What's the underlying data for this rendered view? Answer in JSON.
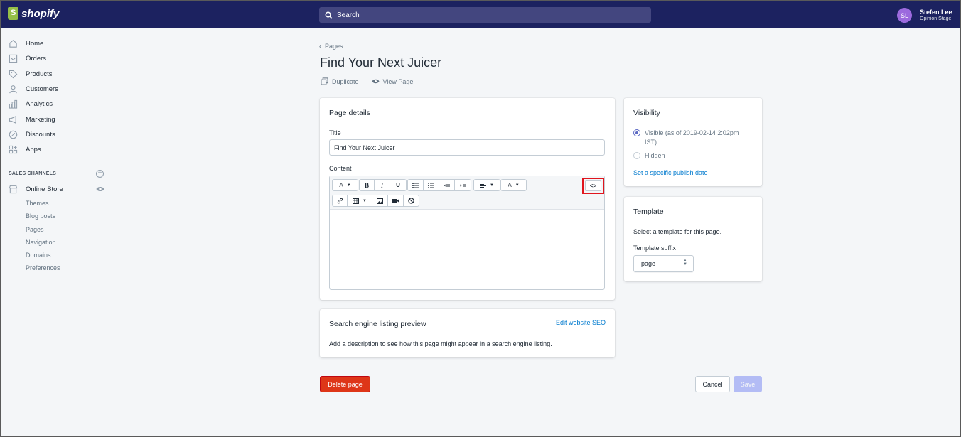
{
  "topbar": {
    "brand": "shopify",
    "search_placeholder": "Search",
    "user": {
      "initials": "SL",
      "name": "Stefen Lee",
      "store": "Opinion Stage"
    }
  },
  "sidebar": {
    "items": [
      {
        "label": "Home",
        "icon": "home-icon"
      },
      {
        "label": "Orders",
        "icon": "orders-icon"
      },
      {
        "label": "Products",
        "icon": "tag-icon"
      },
      {
        "label": "Customers",
        "icon": "person-icon"
      },
      {
        "label": "Analytics",
        "icon": "bar-chart-icon"
      },
      {
        "label": "Marketing",
        "icon": "megaphone-icon"
      },
      {
        "label": "Discounts",
        "icon": "discount-icon"
      },
      {
        "label": "Apps",
        "icon": "apps-icon"
      }
    ],
    "sales_channels_heading": "SALES CHANNELS",
    "online_store": "Online Store",
    "sub_items": [
      "Themes",
      "Blog posts",
      "Pages",
      "Navigation",
      "Domains",
      "Preferences"
    ]
  },
  "header": {
    "breadcrumb": "Pages",
    "title": "Find Your Next Juicer",
    "actions": {
      "duplicate": "Duplicate",
      "view_page": "View Page"
    }
  },
  "page_details": {
    "heading": "Page details",
    "title_label": "Title",
    "title_value": "Find Your Next Juicer",
    "content_label": "Content",
    "toolbar": {
      "font": "A",
      "bold": "B",
      "italic": "I",
      "underline": "U",
      "color": "A",
      "code": "<>"
    }
  },
  "seo": {
    "heading": "Search engine listing preview",
    "edit_link": "Edit website SEO",
    "description": "Add a description to see how this page might appear in a search engine listing."
  },
  "visibility": {
    "heading": "Visibility",
    "visible_label": "Visible (as of 2019-02-14 2:02pm",
    "visible_label_2": "IST)",
    "hidden_label": "Hidden",
    "publish_link": "Set a specific publish date"
  },
  "template": {
    "heading": "Template",
    "description": "Select a template for this page.",
    "suffix_label": "Template suffix",
    "suffix_value": "page"
  },
  "footer": {
    "delete": "Delete page",
    "cancel": "Cancel",
    "save": "Save"
  }
}
